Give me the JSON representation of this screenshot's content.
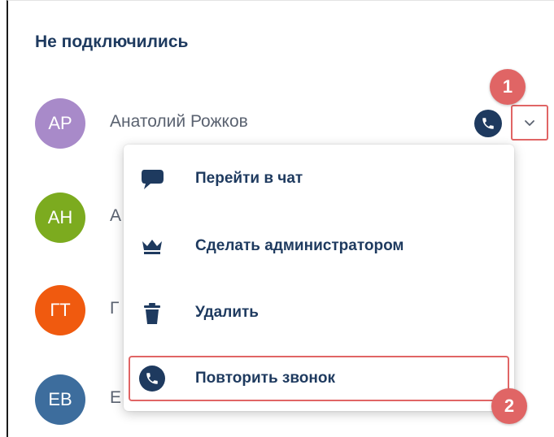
{
  "section": {
    "title": "Не подключились"
  },
  "participants": [
    {
      "initials": "АР",
      "name": "Анатолий Рожков",
      "color": "#a88ac9"
    },
    {
      "initials": "АН",
      "name": "А",
      "color": "#7cab1f"
    },
    {
      "initials": "ГТ",
      "name": "Г",
      "color": "#f05a0f"
    },
    {
      "initials": "ЕВ",
      "name": "Е",
      "color": "#3d6d9d"
    }
  ],
  "participant_actions": {
    "call_icon": "phone-icon",
    "more_icon": "chevron-down-icon"
  },
  "context_menu": {
    "items": [
      {
        "label": "Перейти в чат",
        "icon": "chat-icon"
      },
      {
        "label": "Сделать администратором",
        "icon": "crown-icon"
      },
      {
        "label": "Удалить",
        "icon": "trash-icon"
      },
      {
        "label": "Повторить звонок",
        "icon": "phone-icon"
      }
    ]
  },
  "annotations": {
    "step1": "1",
    "step2": "2"
  },
  "colors": {
    "accent": "#1e3a5f",
    "highlight": "#e06565"
  }
}
